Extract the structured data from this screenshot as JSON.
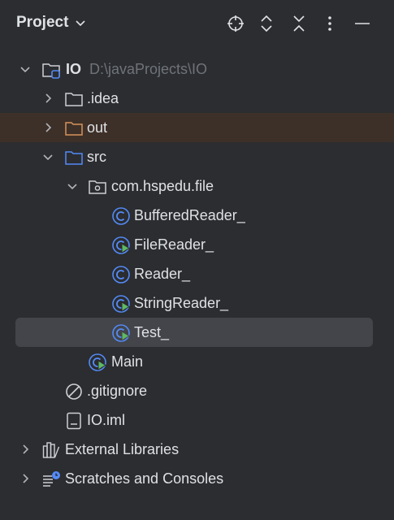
{
  "header": {
    "title": "Project",
    "icons": [
      "title-chevron-down-icon",
      "locate-icon",
      "expand-all-icon",
      "collapse-all-icon",
      "more-options-icon",
      "minimize-icon"
    ]
  },
  "tree": {
    "root": {
      "label": "IO",
      "path": "D:\\javaProjects\\IO"
    },
    "idea": {
      "label": ".idea"
    },
    "out": {
      "label": "out"
    },
    "src": {
      "label": "src"
    },
    "package": {
      "label": "com.hspedu.file"
    },
    "buffered_reader": {
      "label": "BufferedReader_"
    },
    "file_reader": {
      "label": "FileReader_"
    },
    "reader": {
      "label": "Reader_"
    },
    "string_reader": {
      "label": "StringReader_"
    },
    "test": {
      "label": "Test_"
    },
    "main": {
      "label": "Main"
    },
    "gitignore": {
      "label": ".gitignore"
    },
    "iml": {
      "label": "IO.iml"
    },
    "external_libraries": {
      "label": "External Libraries"
    },
    "scratches": {
      "label": "Scratches and Consoles"
    }
  },
  "colors": {
    "background": "#2b2d30",
    "highlight_row": "#3d3028",
    "selected_row": "#43454a",
    "text": "#dfe1e5",
    "path_text": "#6f737a",
    "class_icon": "#548af7",
    "run_badge": "#5fb865",
    "out_folder": "#d6925b"
  }
}
